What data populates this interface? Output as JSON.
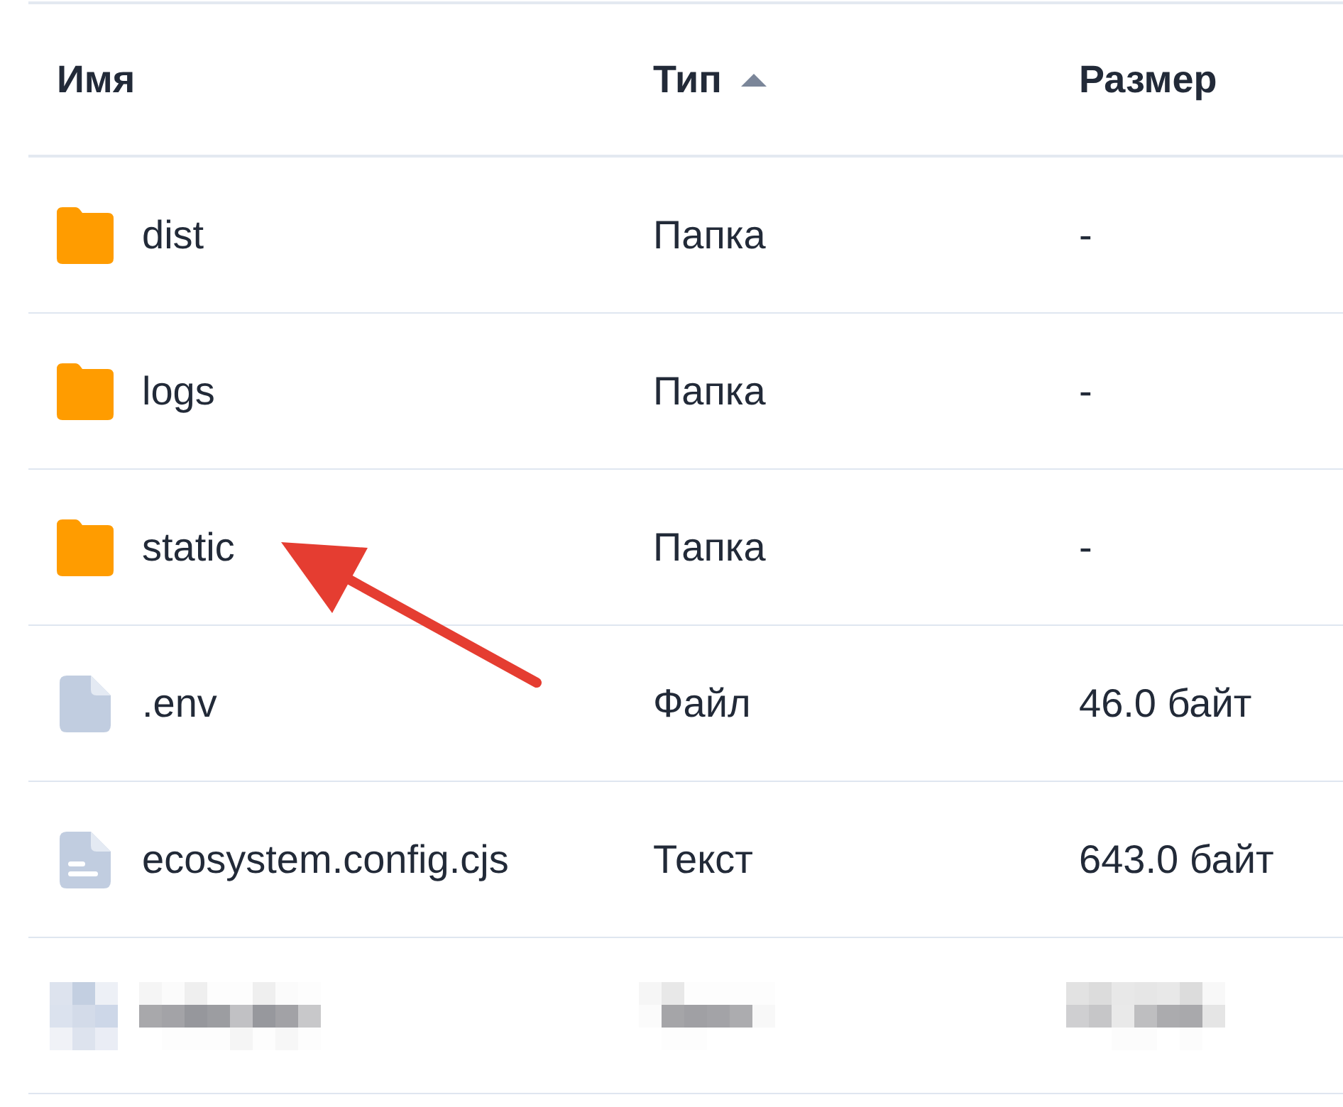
{
  "table": {
    "columns": [
      {
        "label": "Имя",
        "sorted": false
      },
      {
        "label": "Тип",
        "sorted": true
      },
      {
        "label": "Размер",
        "sorted": false
      }
    ],
    "rows": [
      {
        "kind": "folder",
        "name": "dist",
        "type": "Папка",
        "size": "-",
        "arrow": false
      },
      {
        "kind": "folder",
        "name": "logs",
        "type": "Папка",
        "size": "-",
        "arrow": false
      },
      {
        "kind": "folder",
        "name": "static",
        "type": "Папка",
        "size": "-",
        "arrow": true
      },
      {
        "kind": "file",
        "name": ".env",
        "type": "Файл",
        "size": "46.0 байт",
        "arrow": false
      },
      {
        "kind": "text",
        "name": "ecosystem.config.cjs",
        "type": "Текст",
        "size": "643.0 байт",
        "arrow": false
      },
      {
        "kind": "redacted",
        "arrow": false
      }
    ]
  }
}
